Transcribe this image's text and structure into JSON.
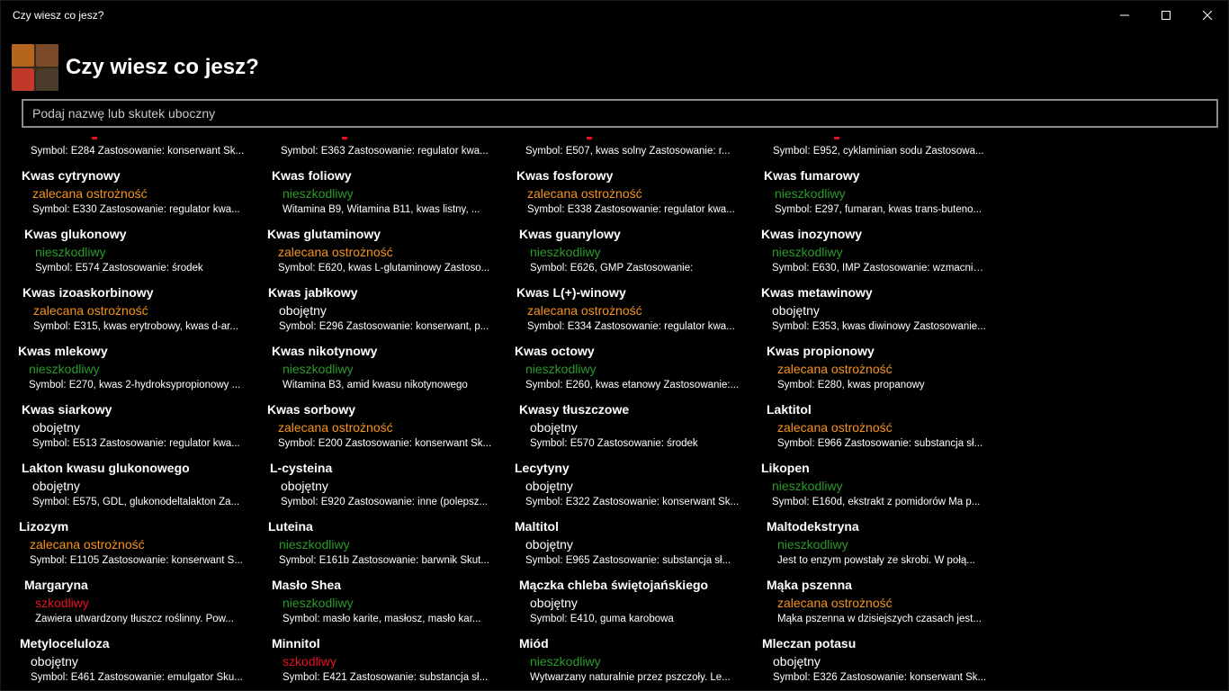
{
  "window": {
    "title": "Czy wiesz co jesz?"
  },
  "caption": {
    "minimize": "minimize-icon",
    "maximize": "maximize-icon",
    "close": "close-icon"
  },
  "header": {
    "title": "Czy wiesz co jesz?",
    "logo_icon": "spices-logo"
  },
  "search": {
    "placeholder": "Podaj nazwę lub skutek uboczny",
    "value": ""
  },
  "colors": {
    "safe": "#2b9a2b",
    "caution": "#f7941d",
    "neutral": "#ffffff",
    "harmful": "#e81123"
  },
  "partial_row": [
    {
      "desc": "Symbol: E284 Zastosowanie: konserwant Sk..."
    },
    {
      "desc": "Symbol: E363 Zastosowanie: regulator kwa..."
    },
    {
      "desc": "Symbol: E507, kwas solny Zastosowanie: r..."
    },
    {
      "desc": "Symbol: E952, cyklaminian sodu Zastosowa..."
    }
  ],
  "items": [
    {
      "name": "Kwas cytrynowy",
      "status": "zalecana ostrożność",
      "type": "caution",
      "desc": "Symbol: E330 Zastosowanie: regulator kwa..."
    },
    {
      "name": "Kwas foliowy",
      "status": "nieszkodliwy",
      "type": "safe",
      "desc": "Witamina B9, Witamina B11, kwas listny, ..."
    },
    {
      "name": "Kwas fosforowy",
      "status": "zalecana ostrożność",
      "type": "caution",
      "desc": "Symbol: E338 Zastosowanie: regulator kwa..."
    },
    {
      "name": "Kwas fumarowy",
      "status": "nieszkodliwy",
      "type": "safe",
      "desc": "Symbol: E297, fumaran, kwas trans-buteno..."
    },
    {
      "name": "Kwas glukonowy",
      "status": "nieszkodliwy",
      "type": "safe",
      "desc": "Symbol: E574 Zastosowanie: środek"
    },
    {
      "name": "Kwas glutaminowy",
      "status": "zalecana ostrożność",
      "type": "caution",
      "desc": "Symbol: E620, kwas L-glutaminowy Zastoso..."
    },
    {
      "name": "Kwas guanylowy",
      "status": "nieszkodliwy",
      "type": "safe",
      "desc": "Symbol: E626, GMP Zastosowanie:"
    },
    {
      "name": "Kwas inozynowy",
      "status": "nieszkodliwy",
      "type": "safe",
      "desc": "Symbol: E630, IMP Zastosowanie: wzmacnia..."
    },
    {
      "name": "Kwas izoaskorbinowy",
      "status": "zalecana ostrożność",
      "type": "caution",
      "desc": "Symbol: E315, kwas erytrobowy, kwas d-ar..."
    },
    {
      "name": "Kwas jabłkowy",
      "status": "obojętny",
      "type": "neutral",
      "desc": "Symbol: E296 Zastosowanie: konserwant, p..."
    },
    {
      "name": "Kwas L(+)-winowy",
      "status": "zalecana ostrożność",
      "type": "caution",
      "desc": "Symbol: E334 Zastosowanie: regulator kwa..."
    },
    {
      "name": "Kwas metawinowy",
      "status": "obojętny",
      "type": "neutral",
      "desc": "Symbol: E353, kwas diwinowy Zastosowanie..."
    },
    {
      "name": "Kwas mlekowy",
      "status": "nieszkodliwy",
      "type": "safe",
      "desc": "Symbol: E270, kwas 2-hydroksypropionowy ..."
    },
    {
      "name": "Kwas nikotynowy",
      "status": "nieszkodliwy",
      "type": "safe",
      "desc": "Witamina B3, amid kwasu nikotynowego"
    },
    {
      "name": "Kwas octowy",
      "status": "nieszkodliwy",
      "type": "safe",
      "desc": "Symbol: E260, kwas etanowy Zastosowanie:..."
    },
    {
      "name": "Kwas propionowy",
      "status": "zalecana ostrożność",
      "type": "caution",
      "desc": "Symbol: E280, kwas propanowy"
    },
    {
      "name": "Kwas siarkowy",
      "status": "obojętny",
      "type": "neutral",
      "desc": "Symbol: E513 Zastosowanie: regulator kwa..."
    },
    {
      "name": "Kwas sorbowy",
      "status": "zalecana ostrożność",
      "type": "caution",
      "desc": "Symbol: E200 Zastosowanie: konserwant Sk..."
    },
    {
      "name": "Kwasy tłuszczowe",
      "status": "obojętny",
      "type": "neutral",
      "desc": "Symbol: E570 Zastosowanie: środek"
    },
    {
      "name": "Laktitol",
      "status": "zalecana ostrożność",
      "type": "caution",
      "desc": "Symbol: E966 Zastosowanie: substancja sł..."
    },
    {
      "name": "Lakton kwasu glukonowego",
      "status": "obojętny",
      "type": "neutral",
      "desc": "Symbol: E575, GDL, glukonodeltalakton Za..."
    },
    {
      "name": "L-cysteina",
      "status": "obojętny",
      "type": "neutral",
      "desc": "Symbol: E920 Zastosowanie: inne (polepsz..."
    },
    {
      "name": "Lecytyny",
      "status": "obojętny",
      "type": "neutral",
      "desc": "Symbol: E322 Zastosowanie: konserwant Sk..."
    },
    {
      "name": "Likopen",
      "status": "nieszkodliwy",
      "type": "safe",
      "desc": "Symbol: E160d, ekstrakt z pomidorów Ma p..."
    },
    {
      "name": "Lizozym",
      "status": "zalecana ostrożność",
      "type": "caution",
      "desc": "Symbol: E1105 Zastosowanie: konserwant S..."
    },
    {
      "name": "Luteina",
      "status": "nieszkodliwy",
      "type": "safe",
      "desc": "Symbol: E161b Zastosowanie: barwnik Skut..."
    },
    {
      "name": "Maltitol",
      "status": "obojętny",
      "type": "neutral",
      "desc": "Symbol: E965 Zastosowanie: substancja sł..."
    },
    {
      "name": "Maltodekstryna",
      "status": "nieszkodliwy",
      "type": "safe",
      "desc": "Jest to enzym powstały ze skrobi. W połą..."
    },
    {
      "name": "Margaryna",
      "status": "szkodliwy",
      "type": "harmful",
      "desc": "Zawiera utwardzony tłuszcz roślinny. Pow..."
    },
    {
      "name": "Masło Shea",
      "status": "nieszkodliwy",
      "type": "safe",
      "desc": "Symbol: masło karite, masłosz, masło kar..."
    },
    {
      "name": "Mączka chleba świętojańskiego",
      "status": "obojętny",
      "type": "neutral",
      "desc": "Symbol: E410, guma karobowa"
    },
    {
      "name": "Mąka pszenna",
      "status": "zalecana ostrożność",
      "type": "caution",
      "desc": "Mąka pszenna w dzisiejszych czasach jest..."
    },
    {
      "name": "Metyloceluloza",
      "status": "obojętny",
      "type": "neutral",
      "desc": "Symbol: E461 Zastosowanie: emulgator Sku..."
    },
    {
      "name": "Minnitol",
      "status": "szkodliwy",
      "type": "harmful",
      "desc": "Symbol: E421 Zastosowanie: substancja sł..."
    },
    {
      "name": "Miód",
      "status": "nieszkodliwy",
      "type": "safe",
      "desc": "Wytwarzany naturalnie przez pszczoły. Le..."
    },
    {
      "name": "Mleczan potasu",
      "status": "obojętny",
      "type": "neutral",
      "desc": "Symbol: E326 Zastosowanie: konserwant Sk..."
    }
  ]
}
